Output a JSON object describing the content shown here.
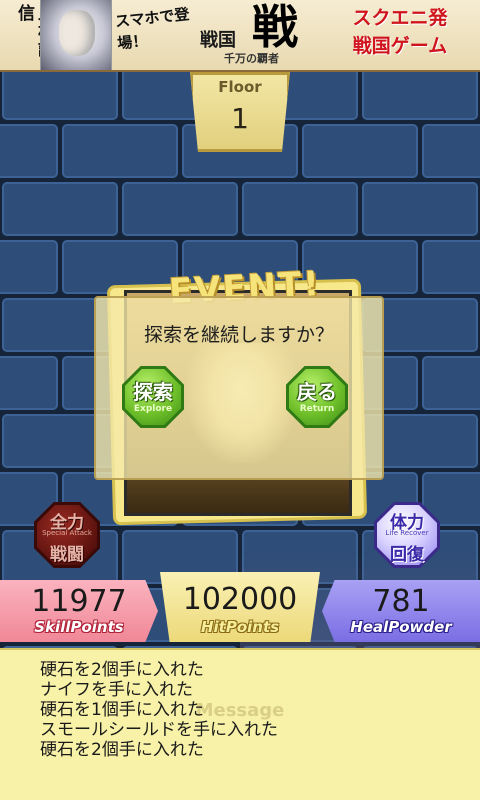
{
  "banner": {
    "vertical_text": "上杉謙信",
    "catch_copy": "スマホで登場！",
    "logo_kanji": "戦国",
    "logo_big": "戦",
    "logo_sub": "千万の覇者",
    "right_text_1": "スクエニ発",
    "right_text_2": "戦国ゲーム"
  },
  "floor": {
    "label": "Floor",
    "value": "1"
  },
  "event": {
    "title": "EVENT!",
    "dialog_text": "探索を継続しますか？",
    "explore_button": {
      "jp": "探索",
      "en": "Explore"
    },
    "return_button": {
      "jp": "戻る",
      "en": "Return"
    }
  },
  "skills": {
    "special_attack": {
      "top": "全力",
      "mid": "Special Attack",
      "bottom": "戦闘"
    },
    "life_recover": {
      "top": "体力",
      "mid": "Life Recover",
      "bottom": "回復"
    }
  },
  "stats": {
    "skill_points": {
      "value": "11977",
      "label": "SkillPoints"
    },
    "hit_points": {
      "value": "102000",
      "label": "HitPoints"
    },
    "heal_powder": {
      "value": "781",
      "label": "HealPowder"
    }
  },
  "message": {
    "title": "Message",
    "lines": [
      "硬石を2個手に入れた",
      "ナイフを手に入れた",
      "硬石を1個手に入れた",
      "スモールシールドを手に入れた",
      "硬石を2個手に入れた"
    ]
  },
  "colors": {
    "wall_brick": "#2e4d78",
    "wall_mortar": "#16243a",
    "dialog_bg": "#f5e8aa",
    "button_green": "#6fc02a",
    "skill_red": "#f08797",
    "hit_yellow": "#ecd979",
    "heal_purple": "#7a6ee4",
    "message_bg": "#f8f2a8"
  }
}
